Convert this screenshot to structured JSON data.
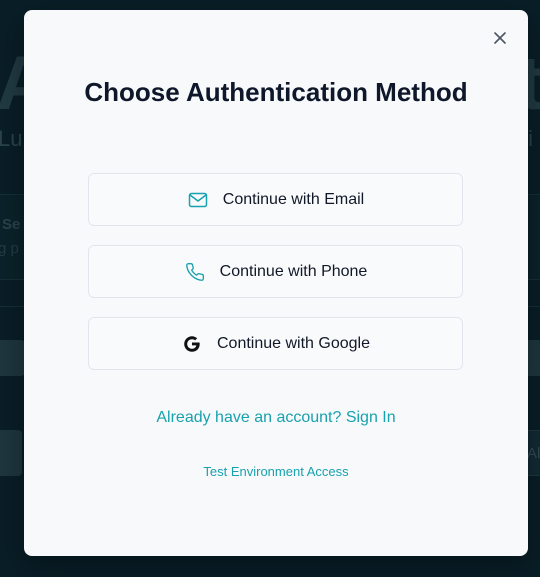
{
  "modal": {
    "title": "Choose Authentication Method",
    "close_icon": "close-icon",
    "options": [
      {
        "label": "Continue with Email",
        "icon": "mail-icon"
      },
      {
        "label": "Continue with Phone",
        "icon": "phone-icon"
      },
      {
        "label": "Continue with Google",
        "icon": "google-icon"
      }
    ],
    "signin_link": "Already have an account? Sign In",
    "test_link": "Test Environment Access"
  },
  "colors": {
    "accent": "#17a2ae",
    "modal_bg": "#f8f9fb",
    "backdrop": "#0c2630",
    "title": "#0f172a"
  }
}
